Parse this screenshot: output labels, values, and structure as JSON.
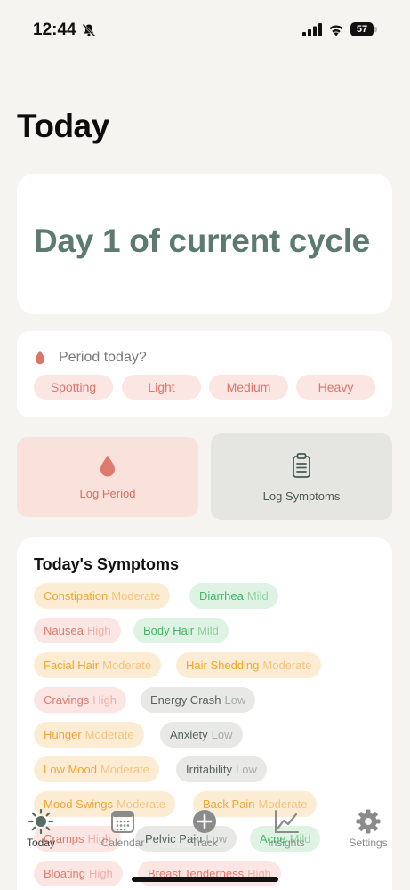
{
  "status_bar": {
    "time": "12:44",
    "battery": "57"
  },
  "title": "Today",
  "cycle": {
    "text": "Day 1 of current cycle"
  },
  "period": {
    "question": "Period today?",
    "options": [
      "Spotting",
      "Light",
      "Medium",
      "Heavy"
    ]
  },
  "actions": {
    "log_period": "Log Period",
    "log_symptoms": "Log Symptoms"
  },
  "symptoms": {
    "title": "Today's Symptoms",
    "items": [
      {
        "name": "Constipation",
        "severity": "Moderate"
      },
      {
        "name": "Diarrhea",
        "severity": "Mild"
      },
      {
        "name": "Nausea",
        "severity": "High"
      },
      {
        "name": "Body Hair",
        "severity": "Mild"
      },
      {
        "name": "Facial Hair",
        "severity": "Moderate"
      },
      {
        "name": "Hair Shedding",
        "severity": "Moderate"
      },
      {
        "name": "Cravings",
        "severity": "High"
      },
      {
        "name": "Energy Crash",
        "severity": "Low"
      },
      {
        "name": "Hunger",
        "severity": "Moderate"
      },
      {
        "name": "Anxiety",
        "severity": "Low"
      },
      {
        "name": "Low Mood",
        "severity": "Moderate"
      },
      {
        "name": "Irritability",
        "severity": "Low"
      },
      {
        "name": "Mood Swings",
        "severity": "Moderate"
      },
      {
        "name": "Back Pain",
        "severity": "Moderate"
      },
      {
        "name": "Cramps",
        "severity": "High"
      },
      {
        "name": "Pelvic Pain",
        "severity": "Low"
      },
      {
        "name": "Acne",
        "severity": "Mild"
      },
      {
        "name": "Bloating",
        "severity": "High"
      },
      {
        "name": "Breast Tenderness",
        "severity": "High"
      }
    ]
  },
  "tabs": [
    {
      "label": "Today",
      "icon": "sun-icon"
    },
    {
      "label": "Calendar",
      "icon": "calendar-icon"
    },
    {
      "label": "Track",
      "icon": "plus-circle-icon"
    },
    {
      "label": "Insights",
      "icon": "chart-icon"
    },
    {
      "label": "Settings",
      "icon": "gear-icon"
    }
  ],
  "colors": {
    "accent_green": "#5d7a70",
    "period_red": "#d9776a",
    "moderate": "#f0a533",
    "mild": "#43b563",
    "high": "#dd7b6e",
    "low": "#566360"
  }
}
